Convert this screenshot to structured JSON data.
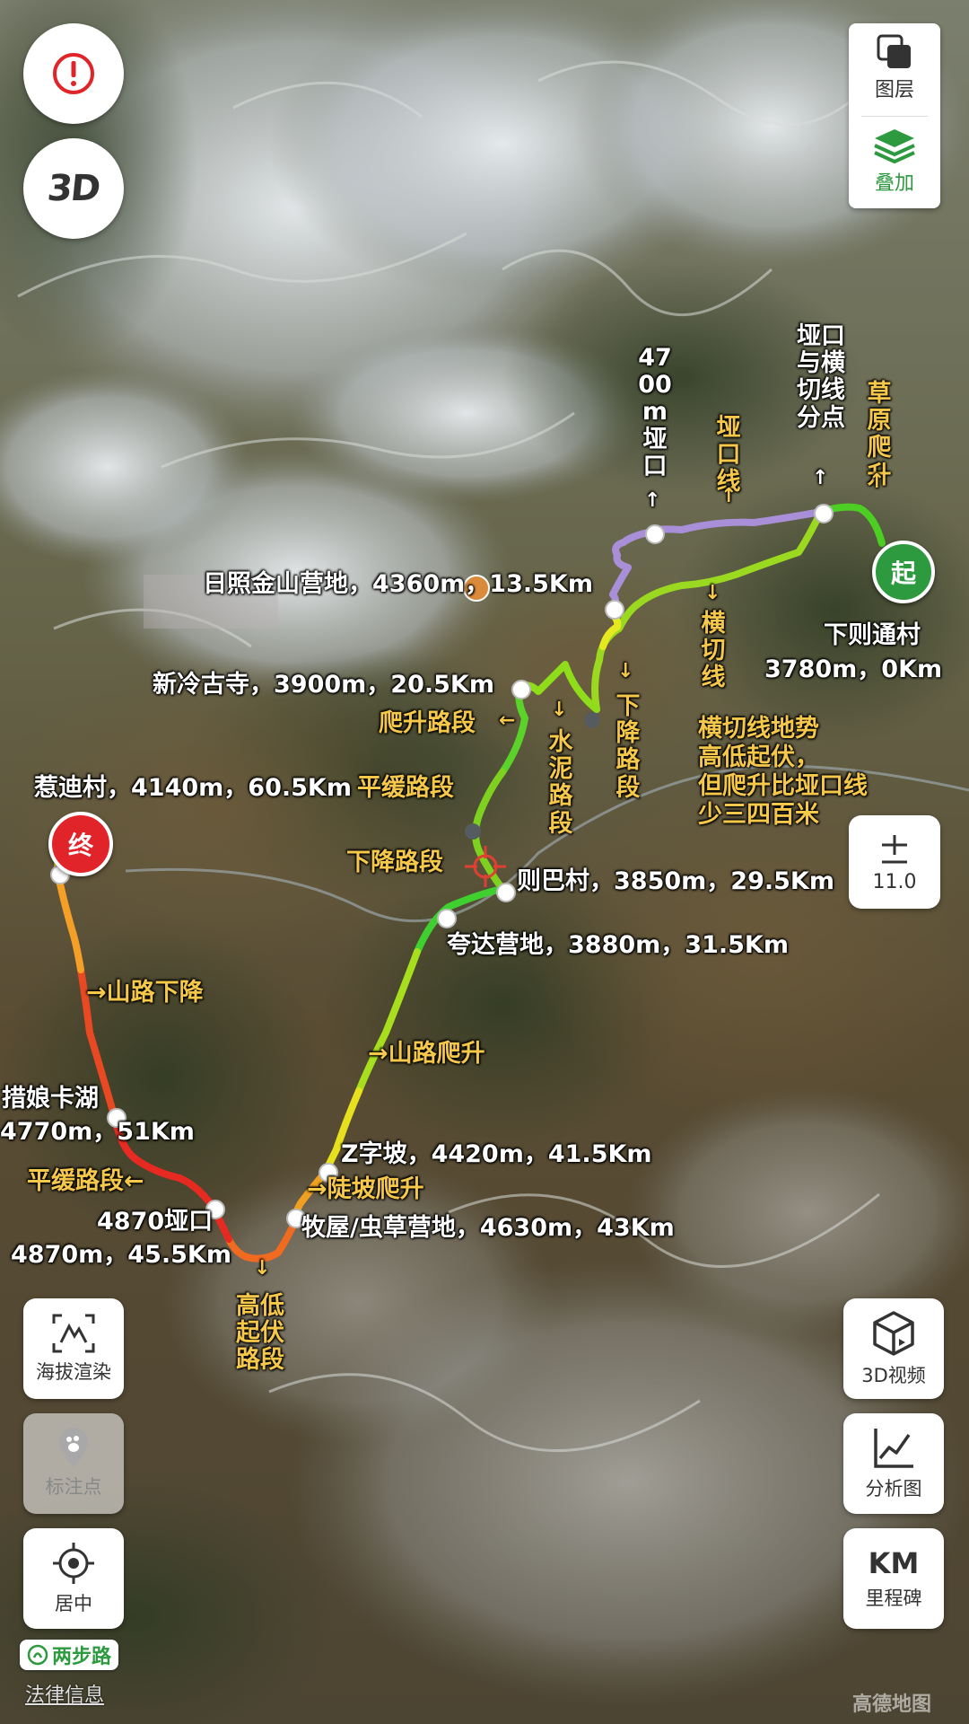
{
  "map": {
    "start_marker": "起",
    "end_marker": "终",
    "labels": {
      "start_village": "下则通村",
      "start_info": "3780m，0Km",
      "grassland_climb": "草原爬升",
      "pass_junction": "垭口与横切线分点",
      "pass_line": "垭口线",
      "pass_4700": "4700m垭口",
      "traverse_line": "横切线",
      "traverse_note_1": "横切线地势",
      "traverse_note_2": "高低起伏，",
      "traverse_note_3": "但爬升比垭口线",
      "traverse_note_4": "少三四百米",
      "rizhao_camp": "日照金山营地，4360m，13.5Km",
      "descent_section_1": "下降路段",
      "xinleng_temple": "新冷古寺，3900m，20.5Km",
      "climb_section": "爬升路段",
      "cement_section": "水泥路段",
      "flat_section_1": "平缓路段",
      "yedi_village": "惹迪村，4140m，60.5Km",
      "descent_section_2": "下降路段",
      "zeba_village": "则巴村，3850m，29.5Km",
      "kuada_camp": "夸达营地，3880m，31.5Km",
      "mountain_descent": "山路下降",
      "mountain_climb": "山路爬升",
      "cuoniang_lake": "措娘卡湖",
      "cuoniang_info": "4770m，51Km",
      "z_slope": "Z字坡，4420m，41.5Km",
      "steep_climb": "陡坡爬升",
      "flat_section_2": "平缓路段",
      "pass_4870": "4870垭口",
      "pass_4870_info": "4870m，45.5Km",
      "herder_camp": "牧屋/虫草营地，4630m，43Km",
      "undulating": "高低起伏路段"
    }
  },
  "controls": {
    "layers_label": "图层",
    "overlay_label": "叠加",
    "zoom_level": "11.0",
    "elevation_label": "海拔渲染",
    "markpoint_label": "标注点",
    "center_label": "居中",
    "video3d_label": "3D视频",
    "analysis_label": "分析图",
    "milestone_label": "里程碑",
    "milestone_icon_text": "KM",
    "threed_icon_text": "3D"
  },
  "footer": {
    "brand": "两步路",
    "legal": "法律信息",
    "watermark": "高德地图"
  },
  "colors": {
    "accent_green": "#2e9a3f",
    "end_red": "#e0242a",
    "label_yellow": "#f6c84a",
    "pass_line_purple": "#a98fd8"
  }
}
